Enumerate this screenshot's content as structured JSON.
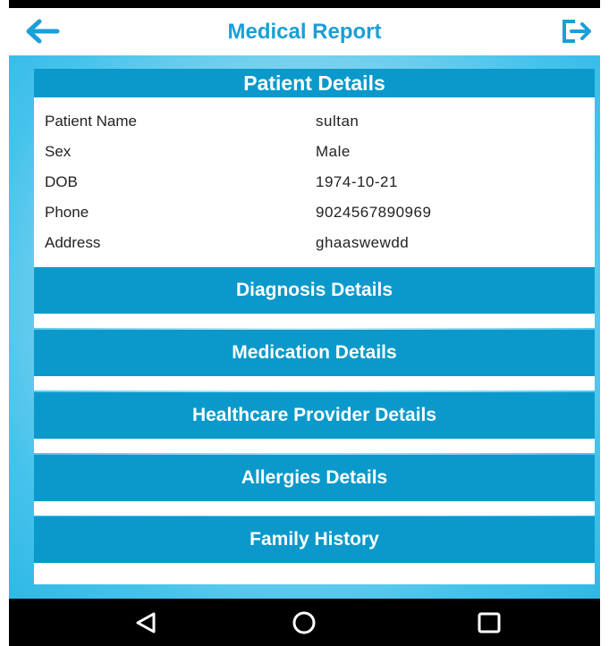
{
  "header": {
    "title": "Medical Report",
    "accent": "#1a9fd6"
  },
  "patient": {
    "title": "Patient Details",
    "fields": [
      {
        "label": "Patient Name",
        "value": "sultan"
      },
      {
        "label": "Sex",
        "value": "Male"
      },
      {
        "label": "DOB",
        "value": "1974-10-21"
      },
      {
        "label": "Phone",
        "value": "9024567890969"
      },
      {
        "label": "Address",
        "value": "ghaaswewdd"
      }
    ]
  },
  "sections": [
    {
      "label": "Diagnosis Details"
    },
    {
      "label": "Medication Details"
    },
    {
      "label": "Healthcare Provider Details"
    },
    {
      "label": "Allergies Details"
    },
    {
      "label": "Family History"
    }
  ],
  "colors": {
    "section_bg": "#0b99cb",
    "background": "#3dbfeb",
    "navbar": "#000000"
  },
  "icons": {
    "back": "arrow-left-icon",
    "logout": "logout-icon",
    "nav_back": "triangle-back-icon",
    "nav_home": "circle-home-icon",
    "nav_recents": "square-recents-icon"
  }
}
